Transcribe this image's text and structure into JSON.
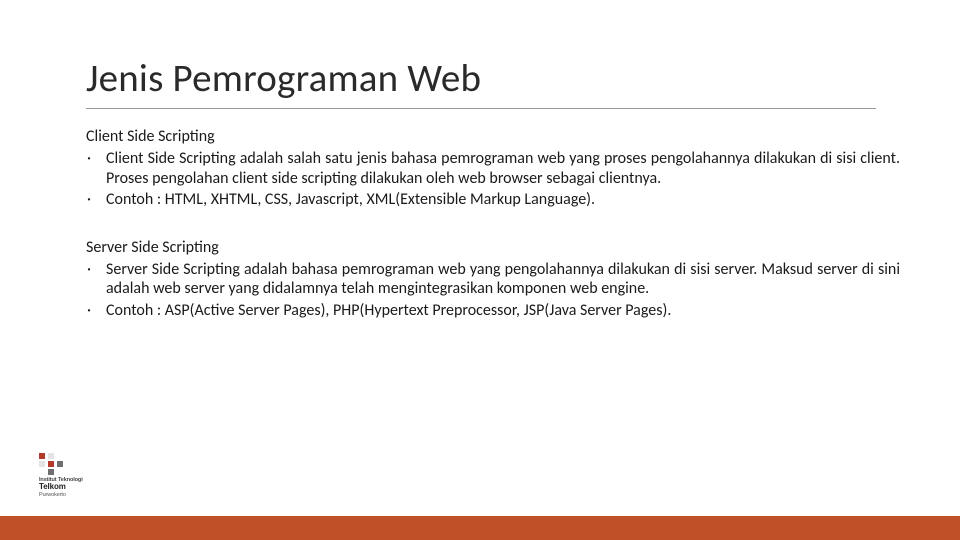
{
  "title": "Jenis Pemrograman Web",
  "sections": [
    {
      "heading": "Client Side Scripting",
      "bullets": [
        "Client Side Scripting adalah salah satu jenis bahasa pemrograman web yang proses pengolahannya dilakukan di sisi client. Proses pengolahan client side scripting dilakukan oleh web browser sebagai clientnya.",
        "Contoh : HTML, XHTML, CSS, Javascript, XML(Extensible Markup Language)."
      ]
    },
    {
      "heading": "Server Side Scripting",
      "bullets": [
        "Server Side Scripting adalah bahasa pemrograman web yang pengolahannya dilakukan di sisi server. Maksud server di sini adalah web server yang didalamnya telah mengintegrasikan komponen web engine.",
        "Contoh : ASP(Active Server Pages), PHP(Hypertext Preprocessor,  JSP(Java Server Pages)."
      ]
    }
  ],
  "logo": {
    "line1": "Institut Teknologi",
    "line2": "Telkom",
    "line3": "Purwokerto"
  },
  "colors": {
    "accent": "#c05028",
    "logo_bar": "#b33a2a"
  }
}
